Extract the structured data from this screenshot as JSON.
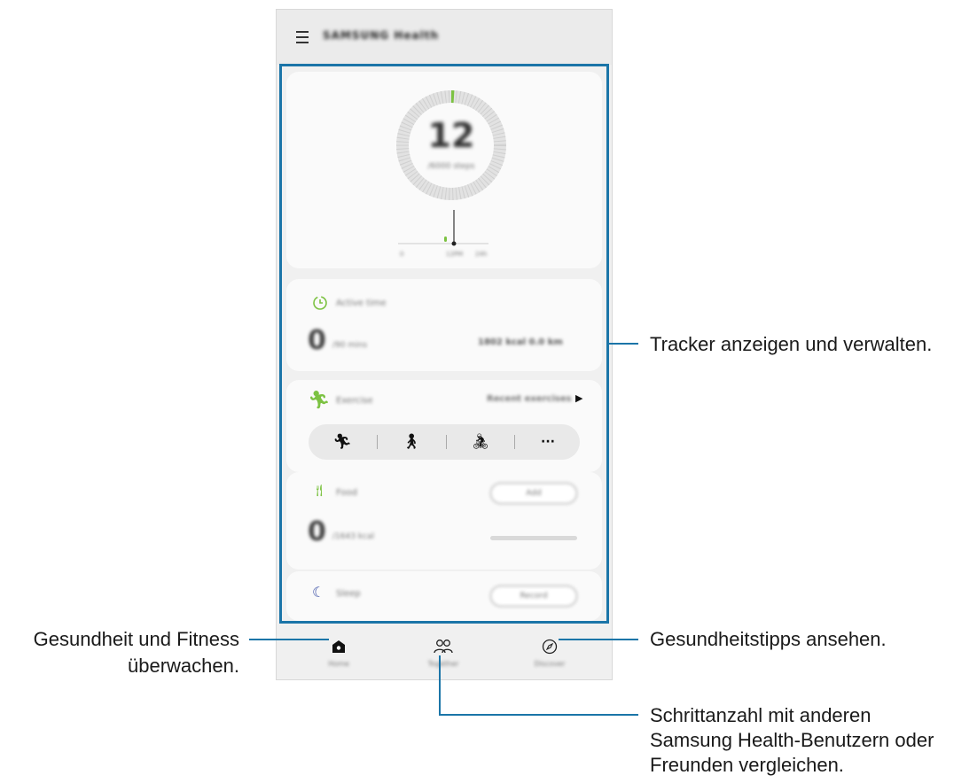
{
  "app": {
    "title": "SAMSUNG Health"
  },
  "steps": {
    "count": "12",
    "target_label": "/6000 steps",
    "chart_ticks": [
      "0",
      "12PM",
      "24h"
    ]
  },
  "active_time": {
    "label": "Active time",
    "value": "0",
    "unit": "/90 mins",
    "stats": "1802 kcal  0.0 km"
  },
  "exercise": {
    "label": "Exercise",
    "link": "Recent exercises",
    "more": "···"
  },
  "food": {
    "label": "Food",
    "value": "0",
    "unit": "/1643 kcal",
    "button": "Add"
  },
  "sleep": {
    "label": "Sleep",
    "button": "Record"
  },
  "nav": {
    "home": "Home",
    "together": "Together",
    "discover": "Discover"
  },
  "annotations": {
    "tracker": "Tracker anzeigen und verwalten.",
    "fitness_line1": "Gesundheit und Fitness",
    "fitness_line2": "überwachen.",
    "tips": "Gesundheitstipps ansehen.",
    "compare_line1": "Schrittanzahl mit anderen",
    "compare_line2": "Samsung Health-Benutzern oder",
    "compare_line3": "Freunden vergleichen."
  },
  "colors": {
    "accent_green": "#7cc242",
    "annotation_blue": "#1b75a8",
    "moon": "#3b4fa6"
  }
}
